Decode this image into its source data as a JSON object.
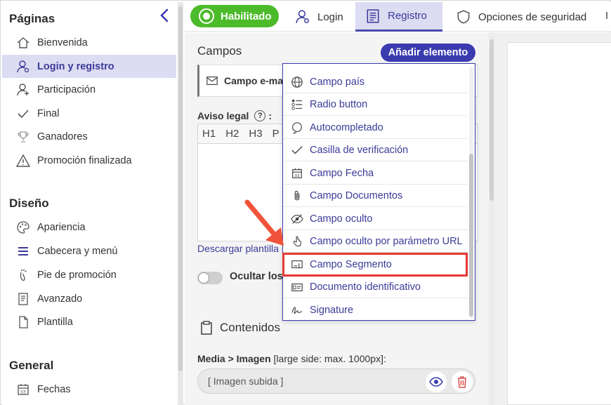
{
  "colors": {
    "accent": "#3b3bb0",
    "active_bg": "#dcdcf3",
    "green": "#4cbb2a",
    "highlight": "#e53935",
    "arrow": "#f0533a"
  },
  "sidebar": {
    "sections": [
      {
        "title": "Páginas",
        "items": [
          {
            "label": "Bienvenida",
            "icon": "home-icon"
          },
          {
            "label": "Login y registro",
            "icon": "user-key-icon",
            "active": true
          },
          {
            "label": "Participación",
            "icon": "user-plus-icon"
          },
          {
            "label": "Final",
            "icon": "check-icon"
          },
          {
            "label": "Ganadores",
            "icon": "trophy-icon"
          },
          {
            "label": "Promoción finalizada",
            "icon": "warning-icon"
          }
        ]
      },
      {
        "title": "Diseño",
        "items": [
          {
            "label": "Apariencia",
            "icon": "palette-icon"
          },
          {
            "label": "Cabecera y menú",
            "icon": "menu-icon"
          },
          {
            "label": "Pie de promoción",
            "icon": "footprint-icon"
          },
          {
            "label": "Avanzado",
            "icon": "document-gear-icon"
          },
          {
            "label": "Plantilla",
            "icon": "file-icon"
          }
        ]
      },
      {
        "title": "General",
        "items": [
          {
            "label": "Fechas",
            "icon": "calendar-icon"
          }
        ]
      }
    ]
  },
  "topbar": {
    "status_label": "Habilitado",
    "tabs": [
      {
        "label": "Login",
        "icon": "user-key-icon"
      },
      {
        "label": "Registro",
        "icon": "form-icon",
        "active": true
      },
      {
        "label": "Opciones de seguridad",
        "icon": "shield-icon"
      }
    ]
  },
  "main": {
    "campos_title": "Campos",
    "add_button": "Añadir elemento",
    "field_card_label": "Campo e-ma",
    "aviso_label": "Aviso legal",
    "aviso_help": "?",
    "aviso_colon": ":",
    "editor_tools": [
      "H1",
      "H2",
      "H3",
      "P"
    ],
    "download_link": "Descargar plantilla",
    "ocultar_label": "Ocultar los",
    "contenidos_title": "Contenidos",
    "media_label": "Media > Imagen",
    "media_hint": "[large side: max. 1000px]:",
    "image_value": "[ Imagen subida ]"
  },
  "dropdown": {
    "items": [
      {
        "label": "Campo país",
        "icon": "globe-icon"
      },
      {
        "label": "Radio button",
        "icon": "radio-list-icon"
      },
      {
        "label": "Autocompletado",
        "icon": "autocomplete-icon"
      },
      {
        "label": "Casilla de verificación",
        "icon": "checkmark-icon"
      },
      {
        "label": "Campo Fecha",
        "icon": "calendar-icon"
      },
      {
        "label": "Campo Documentos",
        "icon": "paperclip-icon"
      },
      {
        "label": "Campo oculto",
        "icon": "eye-off-icon"
      },
      {
        "label": "Campo oculto por parámetro URL",
        "icon": "pointer-icon"
      },
      {
        "label": "Campo Segmento",
        "icon": "segment-icon",
        "highlighted": true
      },
      {
        "label": "Documento identificativo",
        "icon": "id-card-icon"
      },
      {
        "label": "Signature",
        "icon": "signature-icon"
      }
    ]
  }
}
